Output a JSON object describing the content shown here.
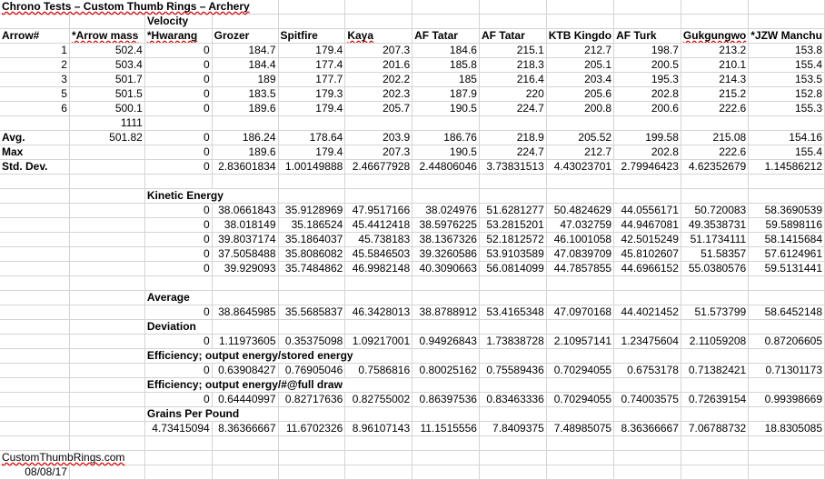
{
  "sheet": {
    "title": "Chrono Tests – Custom Thumb Rings – Archery",
    "velocity_label": "Velocity",
    "headers": [
      "Arrow#",
      "*Arrow mass",
      "*Hwarang",
      "Grozer",
      "Spitfire",
      "Kaya",
      "AF Tatar",
      "AF Tatar",
      "KTB Kingdo",
      "AF Turk",
      "Gukgungwo",
      "*JZW Manchu"
    ],
    "arrows": [
      [
        "1",
        "502.4",
        "0",
        "184.7",
        "179.4",
        "207.3",
        "184.6",
        "215.1",
        "212.7",
        "198.7",
        "213.2",
        "153.8"
      ],
      [
        "2",
        "503.4",
        "0",
        "184.4",
        "177.4",
        "201.6",
        "185.8",
        "218.3",
        "205.1",
        "200.5",
        "210.1",
        "155.4"
      ],
      [
        "3",
        "501.7",
        "0",
        "189",
        "177.7",
        "202.2",
        "185",
        "216.4",
        "203.4",
        "195.3",
        "214.3",
        "153.5"
      ],
      [
        "5",
        "501.5",
        "0",
        "183.5",
        "179.3",
        "202.3",
        "187.9",
        "220",
        "205.6",
        "202.8",
        "215.2",
        "152.8"
      ],
      [
        "6",
        "500.1",
        "0",
        "189.6",
        "179.4",
        "205.7",
        "190.5",
        "224.7",
        "200.8",
        "200.6",
        "222.6",
        "155.3"
      ]
    ],
    "extra_mass": "1111",
    "avg_label": "Avg.",
    "avg": [
      "501.82",
      "0",
      "186.24",
      "178.64",
      "203.9",
      "186.76",
      "218.9",
      "205.52",
      "199.58",
      "215.08",
      "154.16"
    ],
    "max_label": "Max",
    "max": [
      "0",
      "189.6",
      "179.4",
      "207.3",
      "190.5",
      "224.7",
      "212.7",
      "202.8",
      "222.6",
      "155.4"
    ],
    "std_label": "Std. Dev.",
    "std": [
      "0",
      "2.83601834",
      "1.00149888",
      "2.46677928",
      "2.44806046",
      "3.73831513",
      "4.43023701",
      "2.79946423",
      "4.62352679",
      "1.14586212"
    ],
    "ke_label": "Kinetic Energy",
    "ke": [
      [
        "0",
        "38.0661843",
        "35.9128969",
        "47.9517166",
        "38.024976",
        "51.6281277",
        "50.4824629",
        "44.0556171",
        "50.720083",
        "58.3690539"
      ],
      [
        "0",
        "38.018149",
        "35.186524",
        "45.4412418",
        "38.5976225",
        "53.2815201",
        "47.032759",
        "44.9467081",
        "49.3538731",
        "59.5898116"
      ],
      [
        "0",
        "39.8037174",
        "35.1864037",
        "45.738183",
        "38.1367326",
        "52.1812572",
        "46.1001058",
        "42.5015249",
        "51.1734111",
        "58.1415684"
      ],
      [
        "0",
        "37.5058488",
        "35.8086082",
        "45.5846503",
        "39.3260586",
        "53.9103589",
        "47.0839709",
        "45.8102607",
        "51.58357",
        "57.6124961"
      ],
      [
        "0",
        "39.929093",
        "35.7484862",
        "46.9982148",
        "40.3090663",
        "56.0814099",
        "44.7857855",
        "44.6966152",
        "55.0380576",
        "59.5131441"
      ]
    ],
    "average_label": "Average",
    "average": [
      "0",
      "38.8645985",
      "35.5685837",
      "46.3428013",
      "38.8788912",
      "53.4165348",
      "47.0970168",
      "44.4021452",
      "51.573799",
      "58.6452148"
    ],
    "deviation_label": "Deviation",
    "deviation": [
      "0",
      "1.11973605",
      "0.35375098",
      "1.09217001",
      "0.94926843",
      "1.73838728",
      "2.10957141",
      "1.23475604",
      "2.11059208",
      "0.87206605"
    ],
    "eff1_label": "Efficiency; output energy/stored energy",
    "eff1": [
      "0",
      "0.63908427",
      "0.76905046",
      "0.7586816",
      "0.80025162",
      "0.75589436",
      "0.70294055",
      "0.6753178",
      "0.71382421",
      "0.71301173"
    ],
    "eff2_label": "Efficiency; output energy/#@full draw",
    "eff2": [
      "0",
      "0.64440997",
      "0.82717636",
      "0.82755002",
      "0.86397536",
      "0.83463336",
      "0.70294055",
      "0.74003575",
      "0.72639154",
      "0.99398669"
    ],
    "gpp_label": "Grains Per Pound",
    "gpp": [
      "4.73415094",
      "8.36366667",
      "11.6702326",
      "8.96107143",
      "11.1515556",
      "7.8409375",
      "7.48985075",
      "8.36366667",
      "7.06788732",
      "18.8305085"
    ],
    "footer_site": "CustomThumbRings.com",
    "footer_date": "08/08/17"
  }
}
